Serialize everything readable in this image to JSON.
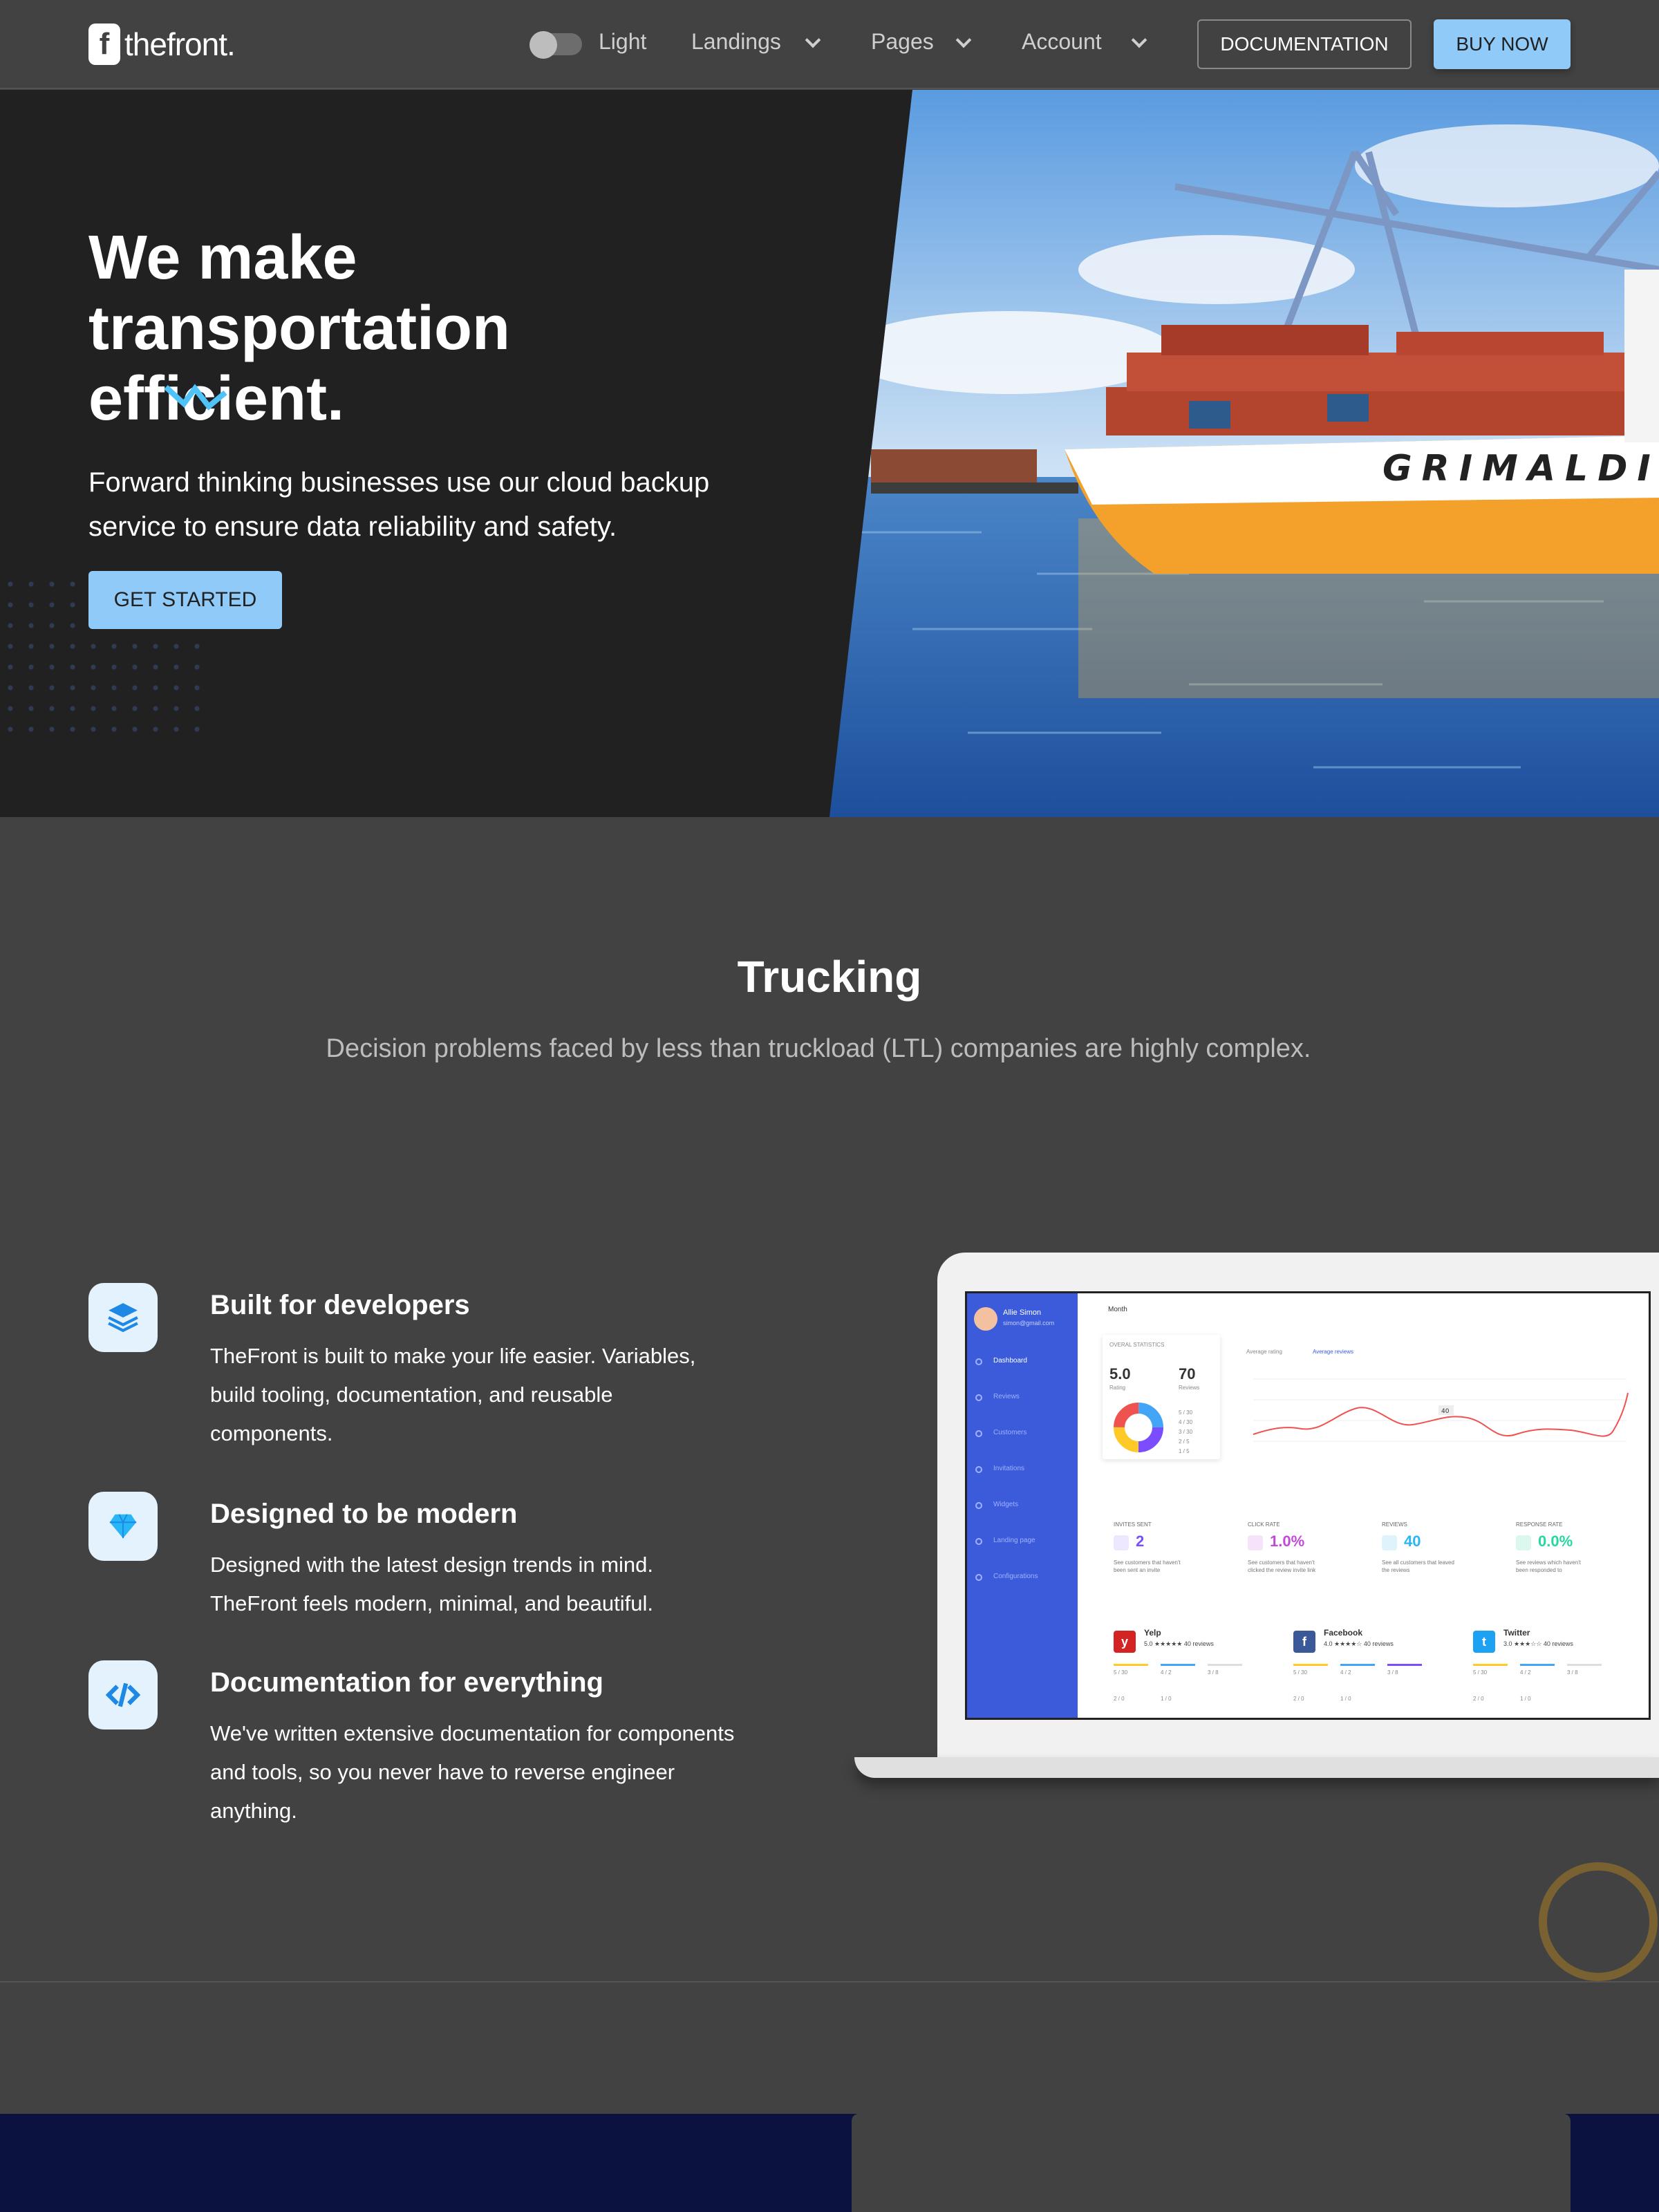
{
  "nav": {
    "logo_mark": "f",
    "logo_text": "thefront.",
    "theme_label": "Light",
    "menu": [
      "Landings",
      "Pages",
      "Account"
    ],
    "documentation_label": "DOCUMENTATION",
    "buy_label": "BUY NOW"
  },
  "hero": {
    "title_line1": "We make",
    "title_line2": "transportation",
    "title_line3": "efficient.",
    "subtitle": "Forward thinking businesses use our cloud backup service to ensure data reliability and safety.",
    "cta_label": "GET STARTED",
    "ship_name": "GRIMALDI"
  },
  "section": {
    "title": "Trucking",
    "subtitle": "Decision problems faced by less than truckload (LTL) companies are highly complex."
  },
  "features": [
    {
      "icon": "layers-icon",
      "title": "Built for developers",
      "text": "TheFront is built to make your life easier. Variables, build tooling, documentation, and reusable components."
    },
    {
      "icon": "diamond-icon",
      "title": "Designed to be modern",
      "text": "Designed with the latest design trends in mind. TheFront feels modern, minimal, and beautiful."
    },
    {
      "icon": "code-icon",
      "title": "Documentation for everything",
      "text": "We've written extensive documentation for components and tools, so you never have to reverse engineer anything."
    }
  ],
  "dashboard": {
    "user_name": "Allie Simon",
    "user_email": "simon@gmail.com",
    "menu": [
      "Dashboard",
      "Reviews",
      "Customers",
      "Invitations",
      "Widgets",
      "Landing page",
      "Configurations"
    ],
    "period": "Month",
    "stats_title": "OVERAL STATISTICS",
    "rating_value": "5.0",
    "rating_label": "Rating",
    "reviews_value": "70",
    "reviews_label": "Reviews",
    "rating_breakdown": [
      "5 / 30",
      "4 / 30",
      "3 / 30",
      "2 / 5",
      "1 / 5"
    ],
    "chart_tabs": [
      "Average rating",
      "Average reviews"
    ],
    "chart_point_label": "40",
    "kpis": [
      {
        "label": "INVITES SENT",
        "value": "2",
        "note": "See customers that haven't been sent an invite",
        "color": "#7c4dff"
      },
      {
        "label": "CLICK RATE",
        "value": "1.0%",
        "note": "See customers that haven't clicked the review invite link",
        "color": "#c04bd9"
      },
      {
        "label": "REVIEWS",
        "value": "40",
        "note": "See all customers that leaved the reviews",
        "color": "#29b6f6"
      },
      {
        "label": "RESPONSE RATE",
        "value": "0.0%",
        "note": "See reviews which haven't been responded to",
        "color": "#26d7a0"
      }
    ],
    "socials": [
      {
        "name": "Yelp",
        "rating": "5.0 ★★★★★ 40 reviews",
        "mark": "y",
        "color": "#d32323"
      },
      {
        "name": "Facebook",
        "rating": "4.0 ★★★★☆ 40 reviews",
        "mark": "f",
        "color": "#3b5998"
      },
      {
        "name": "Twitter",
        "rating": "3.0 ★★★☆☆ 40 reviews",
        "mark": "t",
        "color": "#1da1f2"
      }
    ],
    "social_counts": [
      "5 / 30",
      "4 / 2",
      "3 / 8",
      "2 / 0",
      "1 / 0"
    ]
  },
  "colors": {
    "accent": "#90caf9",
    "hero_bg": "#212121",
    "page_bg": "#424242",
    "sidebar": "#3b5bdb"
  }
}
